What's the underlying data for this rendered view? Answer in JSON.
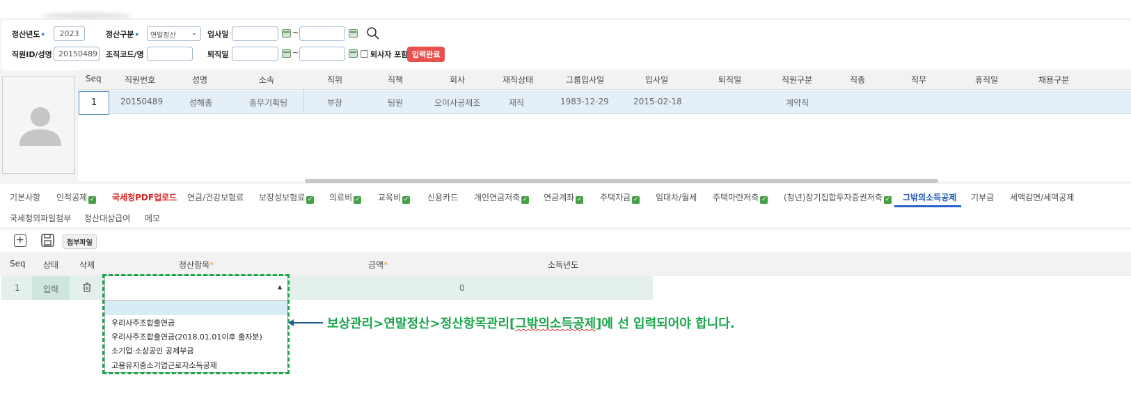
{
  "filters": {
    "year_label": "정산년도",
    "year_value": "2023",
    "type_label": "정산구분",
    "type_value": "연말정산",
    "join_label": "입사일",
    "join_from": "",
    "join_to": "",
    "tilde": "~",
    "emp_label": "직원ID/성명",
    "emp_value": "20150489",
    "org_label": "조직코드/명",
    "org_value": "",
    "retire_label": "퇴직일",
    "retire_from": "",
    "retire_to": "",
    "include_retired_label": "퇴사자 포함",
    "status_badge": "입력완료",
    "required_mark": "•"
  },
  "employee_grid": {
    "columns": [
      "Seq",
      "직원번호",
      "성명",
      "소속",
      "직위",
      "직책",
      "회사",
      "재직상태",
      "그룹입사일",
      "입사일",
      "퇴직일",
      "직원구분",
      "직종",
      "직무",
      "휴직일",
      "채용구분"
    ],
    "row": {
      "seq": "1",
      "emp_no": "20150489",
      "name": "성해종",
      "dept": "총무기획팀",
      "position": "부장",
      "duty": "팀원",
      "company": "오이사공제조",
      "status": "재직",
      "group_join": "1983-12-29",
      "join": "2015-02-18",
      "retire": "",
      "emp_type": "계약직",
      "job_kind": "",
      "job": "",
      "leave": "",
      "hire_type": ""
    }
  },
  "tabs": [
    {
      "label": "기본사항",
      "check": false
    },
    {
      "label": "인적공제",
      "check": true
    },
    {
      "label": "국세청PDF업로드",
      "check": false
    },
    {
      "label": "연금/건강보험료",
      "check": false
    },
    {
      "label": "보장성보험료",
      "check": true
    },
    {
      "label": "의료비",
      "check": true
    },
    {
      "label": "교육비",
      "check": true
    },
    {
      "label": "신용카드",
      "check": false
    },
    {
      "label": "개인연금저축",
      "check": true
    },
    {
      "label": "연금계좌",
      "check": true
    },
    {
      "label": "주택자금",
      "check": true
    },
    {
      "label": "임대차/월세",
      "check": false
    },
    {
      "label": "주택마련저축",
      "check": true
    },
    {
      "label": "(청년)장기집합투자증권저축",
      "check": true
    },
    {
      "label": "그밖의소득공제",
      "check": false
    },
    {
      "label": "기부금",
      "check": false
    },
    {
      "label": "세액감면/세액공제",
      "check": false
    },
    {
      "label": "국세청외파일첨부",
      "check": false
    },
    {
      "label": "정산대상급여",
      "check": false
    },
    {
      "label": "메모",
      "check": false
    }
  ],
  "toolbar": {
    "add_icon": "plus-square-icon",
    "save_icon": "floppy-disk-icon",
    "attach_label": "첨부파일"
  },
  "deduction_grid": {
    "columns": [
      "Seq",
      "상태",
      "삭제",
      "정산항목",
      "금액",
      "소득년도"
    ],
    "required_mark": "*",
    "row": {
      "seq": "1",
      "state": "입력",
      "delete_icon": "trash-icon",
      "item": "",
      "amount": "0",
      "year": ""
    }
  },
  "dropdown_options": [
    "",
    "우리사주조합출연금",
    "우리사주조합출연금(2018.01.01이후 출자분)",
    "소기업·소상공인 공제부금",
    "고용유지중소기업근로자소득공제"
  ],
  "annotation": {
    "prefix": "보상관리>연말정산>정산항목관리[",
    "highlight": "그밖의소득공제",
    "suffix": "]에 선 입력되어야 합니다."
  },
  "colors": {
    "accent_green": "#1aa64c",
    "badge_red": "#e8514e",
    "active_tab_blue": "#1e56b8",
    "arrow_blue": "#1d5b8a"
  }
}
